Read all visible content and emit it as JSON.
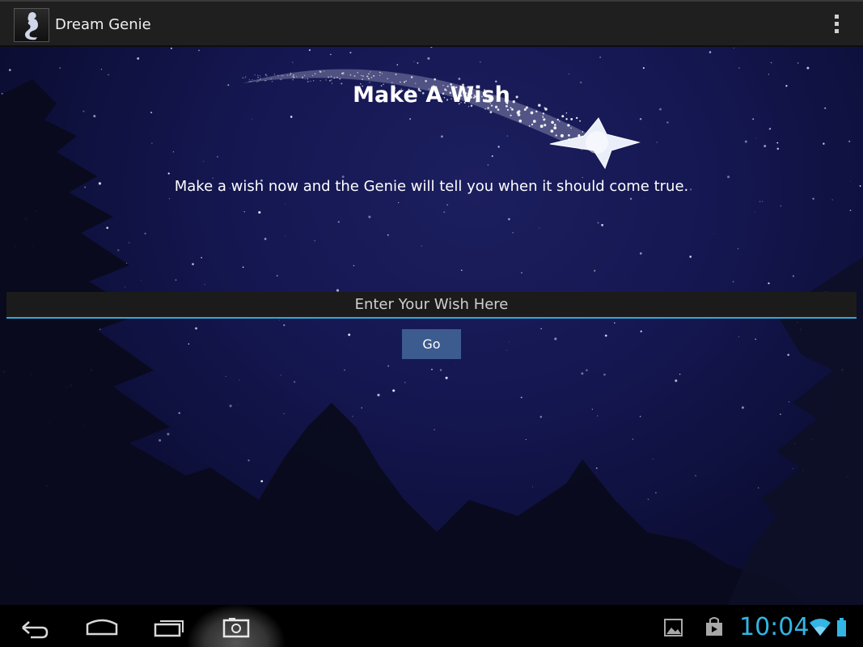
{
  "app": {
    "title": "Dream Genie",
    "icon": "genie-icon"
  },
  "header": {
    "overflow_icon": "overflow-menu-icon"
  },
  "main": {
    "title": "Make A Wish",
    "description": "Make a wish now and the Genie will tell you when it should come true.",
    "wish_input": {
      "placeholder": "Enter Your Wish Here",
      "value": ""
    },
    "go_label": "Go",
    "background": "night-sky-with-shooting-star"
  },
  "nav": {
    "icons": [
      "back-icon",
      "home-icon",
      "recents-icon",
      "screenshot-icon"
    ],
    "status_icons": [
      "gallery-icon",
      "shopping-bag-icon",
      "wifi-icon",
      "battery-icon"
    ],
    "clock": "10:04"
  },
  "colors": {
    "accent": "#33b5e5",
    "button": "#3c5b8e",
    "sky": "#151752"
  }
}
